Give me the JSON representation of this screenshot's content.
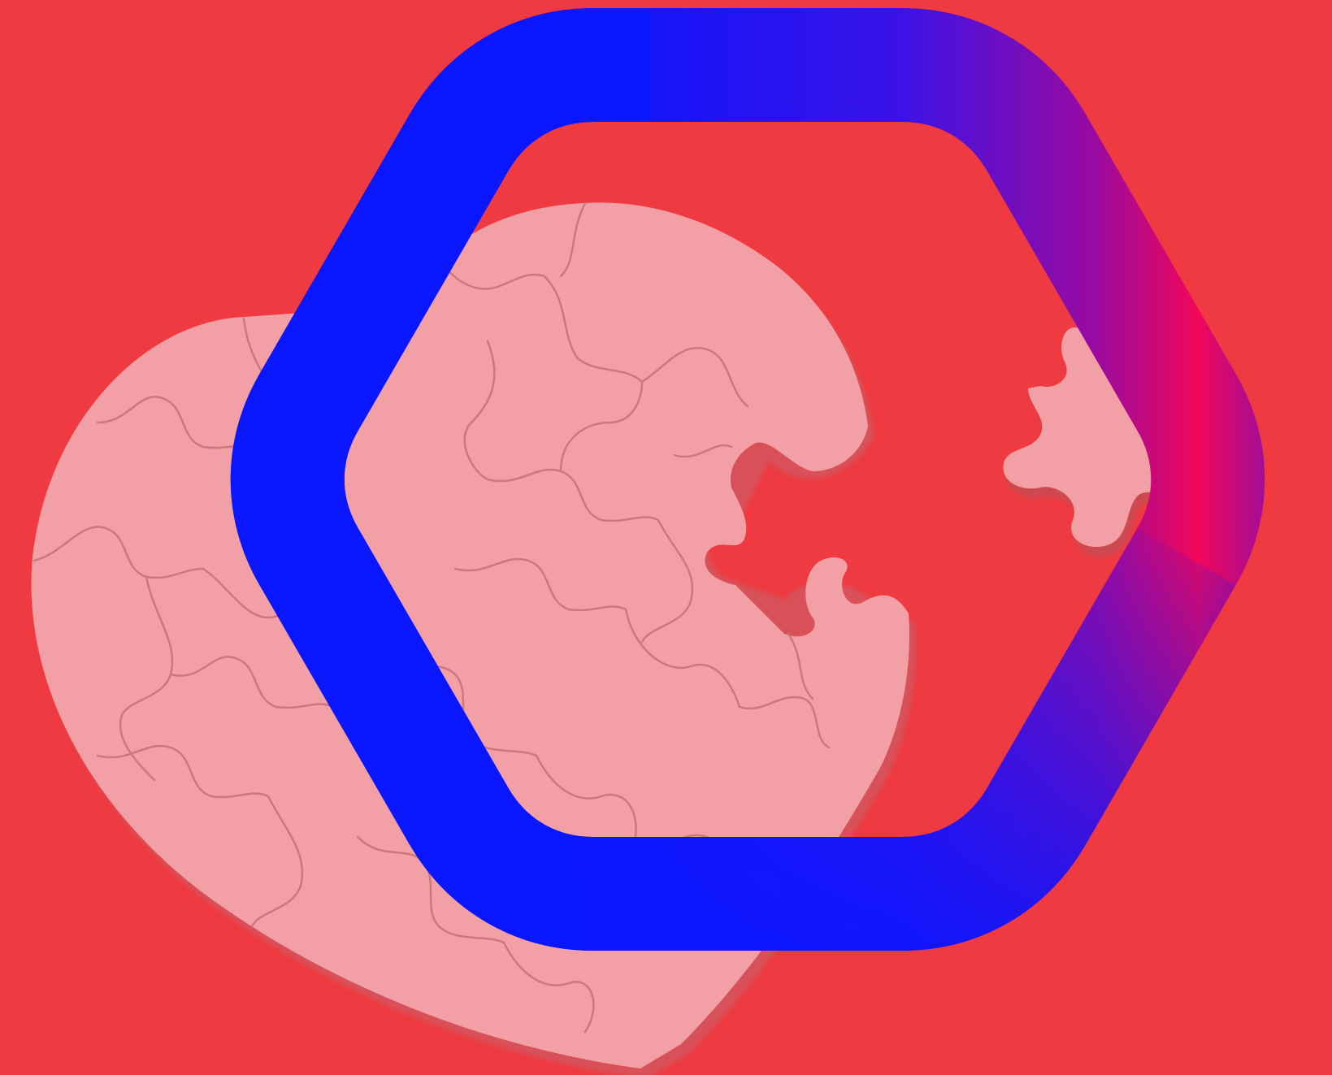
{
  "scene": {
    "description_icon": "heart-jigsaw-puzzle-with-hexagon-frame",
    "colors": {
      "background": "#ee3a40",
      "puzzle": "#f2a0a6",
      "puzzle_shadow": "#d97f87",
      "puzzle_line": "#c76f78",
      "hex_blue": "#0a16ff",
      "hex_purple": "#7a10b8",
      "hex_magenta": "#f0075a"
    },
    "icons": {
      "puzzle_heart": "heart-puzzle-icon",
      "loose_piece": "puzzle-piece-icon",
      "frame": "hexagon-frame-icon"
    }
  }
}
